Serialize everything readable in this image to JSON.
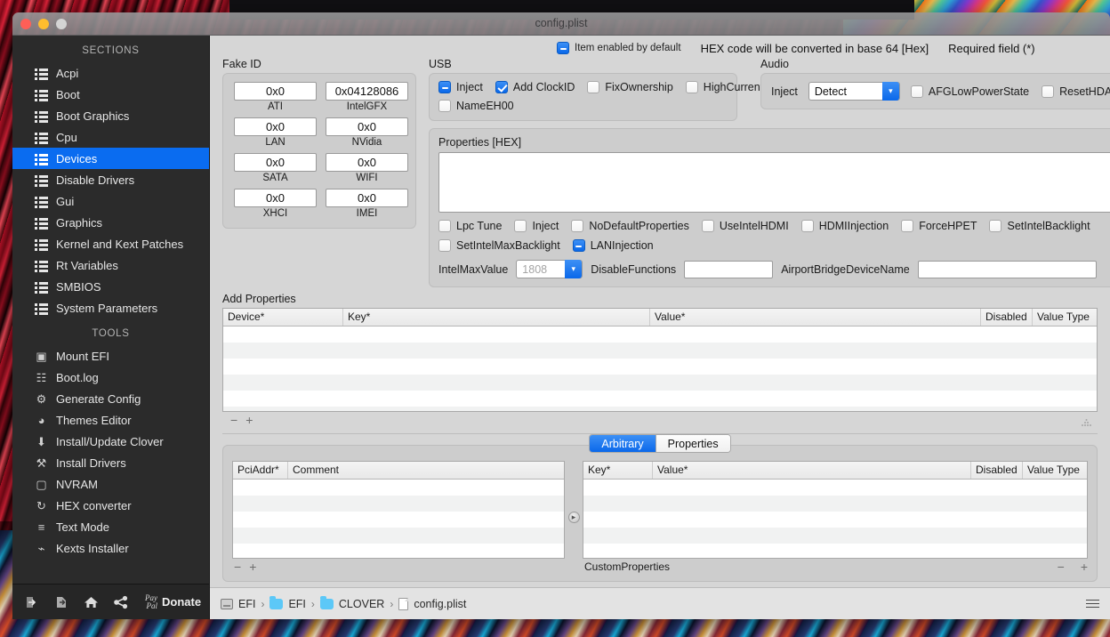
{
  "window": {
    "title": "config.plist",
    "traffic_lights": [
      "close",
      "minimize",
      "zoom"
    ]
  },
  "sidebar": {
    "sections_header": "SECTIONS",
    "sections": [
      {
        "label": "Acpi",
        "icon": "list-icon",
        "selected": false
      },
      {
        "label": "Boot",
        "icon": "list-icon",
        "selected": false
      },
      {
        "label": "Boot Graphics",
        "icon": "list-icon",
        "selected": false
      },
      {
        "label": "Cpu",
        "icon": "list-icon",
        "selected": false
      },
      {
        "label": "Devices",
        "icon": "list-icon",
        "selected": true
      },
      {
        "label": "Disable Drivers",
        "icon": "list-icon",
        "selected": false
      },
      {
        "label": "Gui",
        "icon": "list-icon",
        "selected": false
      },
      {
        "label": "Graphics",
        "icon": "list-icon",
        "selected": false
      },
      {
        "label": "Kernel and Kext Patches",
        "icon": "list-icon",
        "selected": false
      },
      {
        "label": "Rt Variables",
        "icon": "list-icon",
        "selected": false
      },
      {
        "label": "SMBIOS",
        "icon": "list-icon",
        "selected": false
      },
      {
        "label": "System Parameters",
        "icon": "list-icon",
        "selected": false
      }
    ],
    "tools_header": "TOOLS",
    "tools": [
      {
        "label": "Mount EFI",
        "icon": "mount-efi-icon",
        "glyph": "▣"
      },
      {
        "label": "Boot.log",
        "icon": "boot-log-icon",
        "glyph": "☷"
      },
      {
        "label": "Generate Config",
        "icon": "gears-icon",
        "glyph": "⚙"
      },
      {
        "label": "Themes Editor",
        "icon": "palette-icon",
        "glyph": "◕"
      },
      {
        "label": "Install/Update Clover",
        "icon": "download-icon",
        "glyph": "⬇"
      },
      {
        "label": "Install Drivers",
        "icon": "tools-icon",
        "glyph": "⚒"
      },
      {
        "label": "NVRAM",
        "icon": "chip-icon",
        "glyph": "▢"
      },
      {
        "label": "HEX converter",
        "icon": "refresh-icon",
        "glyph": "↻"
      },
      {
        "label": "Text Mode",
        "icon": "text-lines-icon",
        "glyph": "≡"
      },
      {
        "label": "Kexts Installer",
        "icon": "plug-icon",
        "glyph": "⌁"
      }
    ],
    "toolbar": {
      "import_label": "import",
      "export_label": "export",
      "home_label": "home",
      "share_label": "share",
      "paypal_line1": "Pay",
      "paypal_line2": "Pal",
      "donate_label": "Donate"
    }
  },
  "topnotes": {
    "item_enabled_label": "Item enabled by default",
    "item_enabled_state": "mixed",
    "hex_note": "HEX code will be converted in base 64 [Hex]",
    "required_note": "Required field (*)"
  },
  "fake_id": {
    "title": "Fake ID",
    "fields": [
      {
        "caption": "ATI",
        "value": "0x0"
      },
      {
        "caption": "IntelGFX",
        "value": "0x04128086"
      },
      {
        "caption": "LAN",
        "value": "0x0"
      },
      {
        "caption": "NVidia",
        "value": "0x0"
      },
      {
        "caption": "SATA",
        "value": "0x0"
      },
      {
        "caption": "WIFI",
        "value": "0x0"
      },
      {
        "caption": "XHCI",
        "value": "0x0"
      },
      {
        "caption": "IMEI",
        "value": "0x0"
      }
    ]
  },
  "usb": {
    "title": "USB",
    "row1": [
      {
        "label": "Inject",
        "state": "mixed"
      },
      {
        "label": "Add ClockID",
        "state": "on"
      },
      {
        "label": "FixOwnership",
        "state": "off"
      },
      {
        "label": "HighCurrent",
        "state": "off"
      }
    ],
    "row2": [
      {
        "label": "NameEH00",
        "state": "off"
      }
    ]
  },
  "audio": {
    "title": "Audio",
    "inject_label": "Inject",
    "inject_value": "Detect",
    "inject_options": [
      "Detect"
    ],
    "checks": [
      {
        "label": "AFGLowPowerState",
        "state": "off"
      },
      {
        "label": "ResetHDA",
        "state": "off"
      }
    ]
  },
  "properties": {
    "label": "Properties [HEX]",
    "hex_value": "",
    "row1": [
      {
        "label": "Lpc Tune",
        "state": "off"
      },
      {
        "label": "Inject",
        "state": "off"
      },
      {
        "label": "NoDefaultProperties",
        "state": "off"
      },
      {
        "label": "UseIntelHDMI",
        "state": "off"
      },
      {
        "label": "HDMIInjection",
        "state": "off"
      },
      {
        "label": "ForceHPET",
        "state": "off"
      },
      {
        "label": "SetIntelBacklight",
        "state": "off"
      }
    ],
    "row2": [
      {
        "label": "SetIntelMaxBacklight",
        "state": "off"
      },
      {
        "label": "LANInjection",
        "state": "mixed"
      }
    ],
    "intel_max_value_label": "IntelMaxValue",
    "intel_max_value_placeholder": "1808",
    "intel_max_value": "",
    "disable_functions_label": "DisableFunctions",
    "disable_functions_value": "",
    "airport_bridge_label": "AirportBridgeDeviceName",
    "airport_bridge_value": ""
  },
  "add_properties": {
    "title": "Add Properties",
    "columns": [
      "Device*",
      "Key*",
      "Value*",
      "Disabled",
      "Value Type"
    ],
    "rows": [],
    "row_count": 6,
    "remove_label": "−",
    "add_label": "+"
  },
  "bottom": {
    "tabs": [
      {
        "label": "Arbitrary",
        "active": true
      },
      {
        "label": "Properties",
        "active": false
      }
    ],
    "left_table": {
      "columns": [
        "PciAddr*",
        "Comment"
      ],
      "rows": [],
      "row_count": 6,
      "remove_label": "−",
      "add_label": "+"
    },
    "right_table": {
      "columns": [
        "Key*",
        "Value*",
        "Disabled",
        "Value Type"
      ],
      "rows": [],
      "row_count": 6,
      "footer_label": "CustomProperties",
      "remove_label": "−",
      "add_label": "+"
    }
  },
  "statusbar": {
    "breadcrumb": [
      {
        "label": "EFI",
        "icon": "disk-icon"
      },
      {
        "label": "EFI",
        "icon": "folder-icon"
      },
      {
        "label": "CLOVER",
        "icon": "folder-icon"
      },
      {
        "label": "config.plist",
        "icon": "file-icon"
      }
    ],
    "separator": "›",
    "menu_label": "menu"
  },
  "colors": {
    "accent_blue": "#0a68ea",
    "selection_blue": "#0a6cf0",
    "sidebar_bg": "#2b2b2b",
    "content_bg": "#d6d6d6",
    "group_bg": "#cdcdcd"
  }
}
